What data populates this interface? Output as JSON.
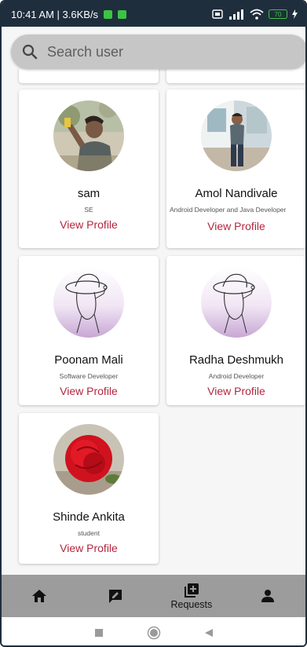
{
  "status_bar": {
    "time_speed": "10:41 AM | 3.6KB/s",
    "battery": "70"
  },
  "search": {
    "placeholder": "Search user"
  },
  "users": [
    {
      "name": "sam",
      "role": "SE",
      "link": "View Profile",
      "avatar": "photo-man-outdoor"
    },
    {
      "name": "Amol Nandivale",
      "role": "Android Developer and Java Developer",
      "link": "View Profile",
      "avatar": "photo-man-standing"
    },
    {
      "name": "Poonam Mali",
      "role": "Software Developer",
      "link": "View Profile",
      "avatar": "illustration-girl-hat"
    },
    {
      "name": "Radha Deshmukh",
      "role": "Android Developer",
      "link": "View Profile",
      "avatar": "illustration-girl-hat"
    },
    {
      "name": "Shinde Ankita",
      "role": "student",
      "link": "View Profile",
      "avatar": "photo-red-rose"
    }
  ],
  "bottom_nav": {
    "requests_label": "Requests"
  },
  "colors": {
    "status_bar": "#1f2e3d",
    "link": "#b3263e",
    "nav_bg": "#9c9c9c",
    "search_bg": "#c6c6c6"
  }
}
